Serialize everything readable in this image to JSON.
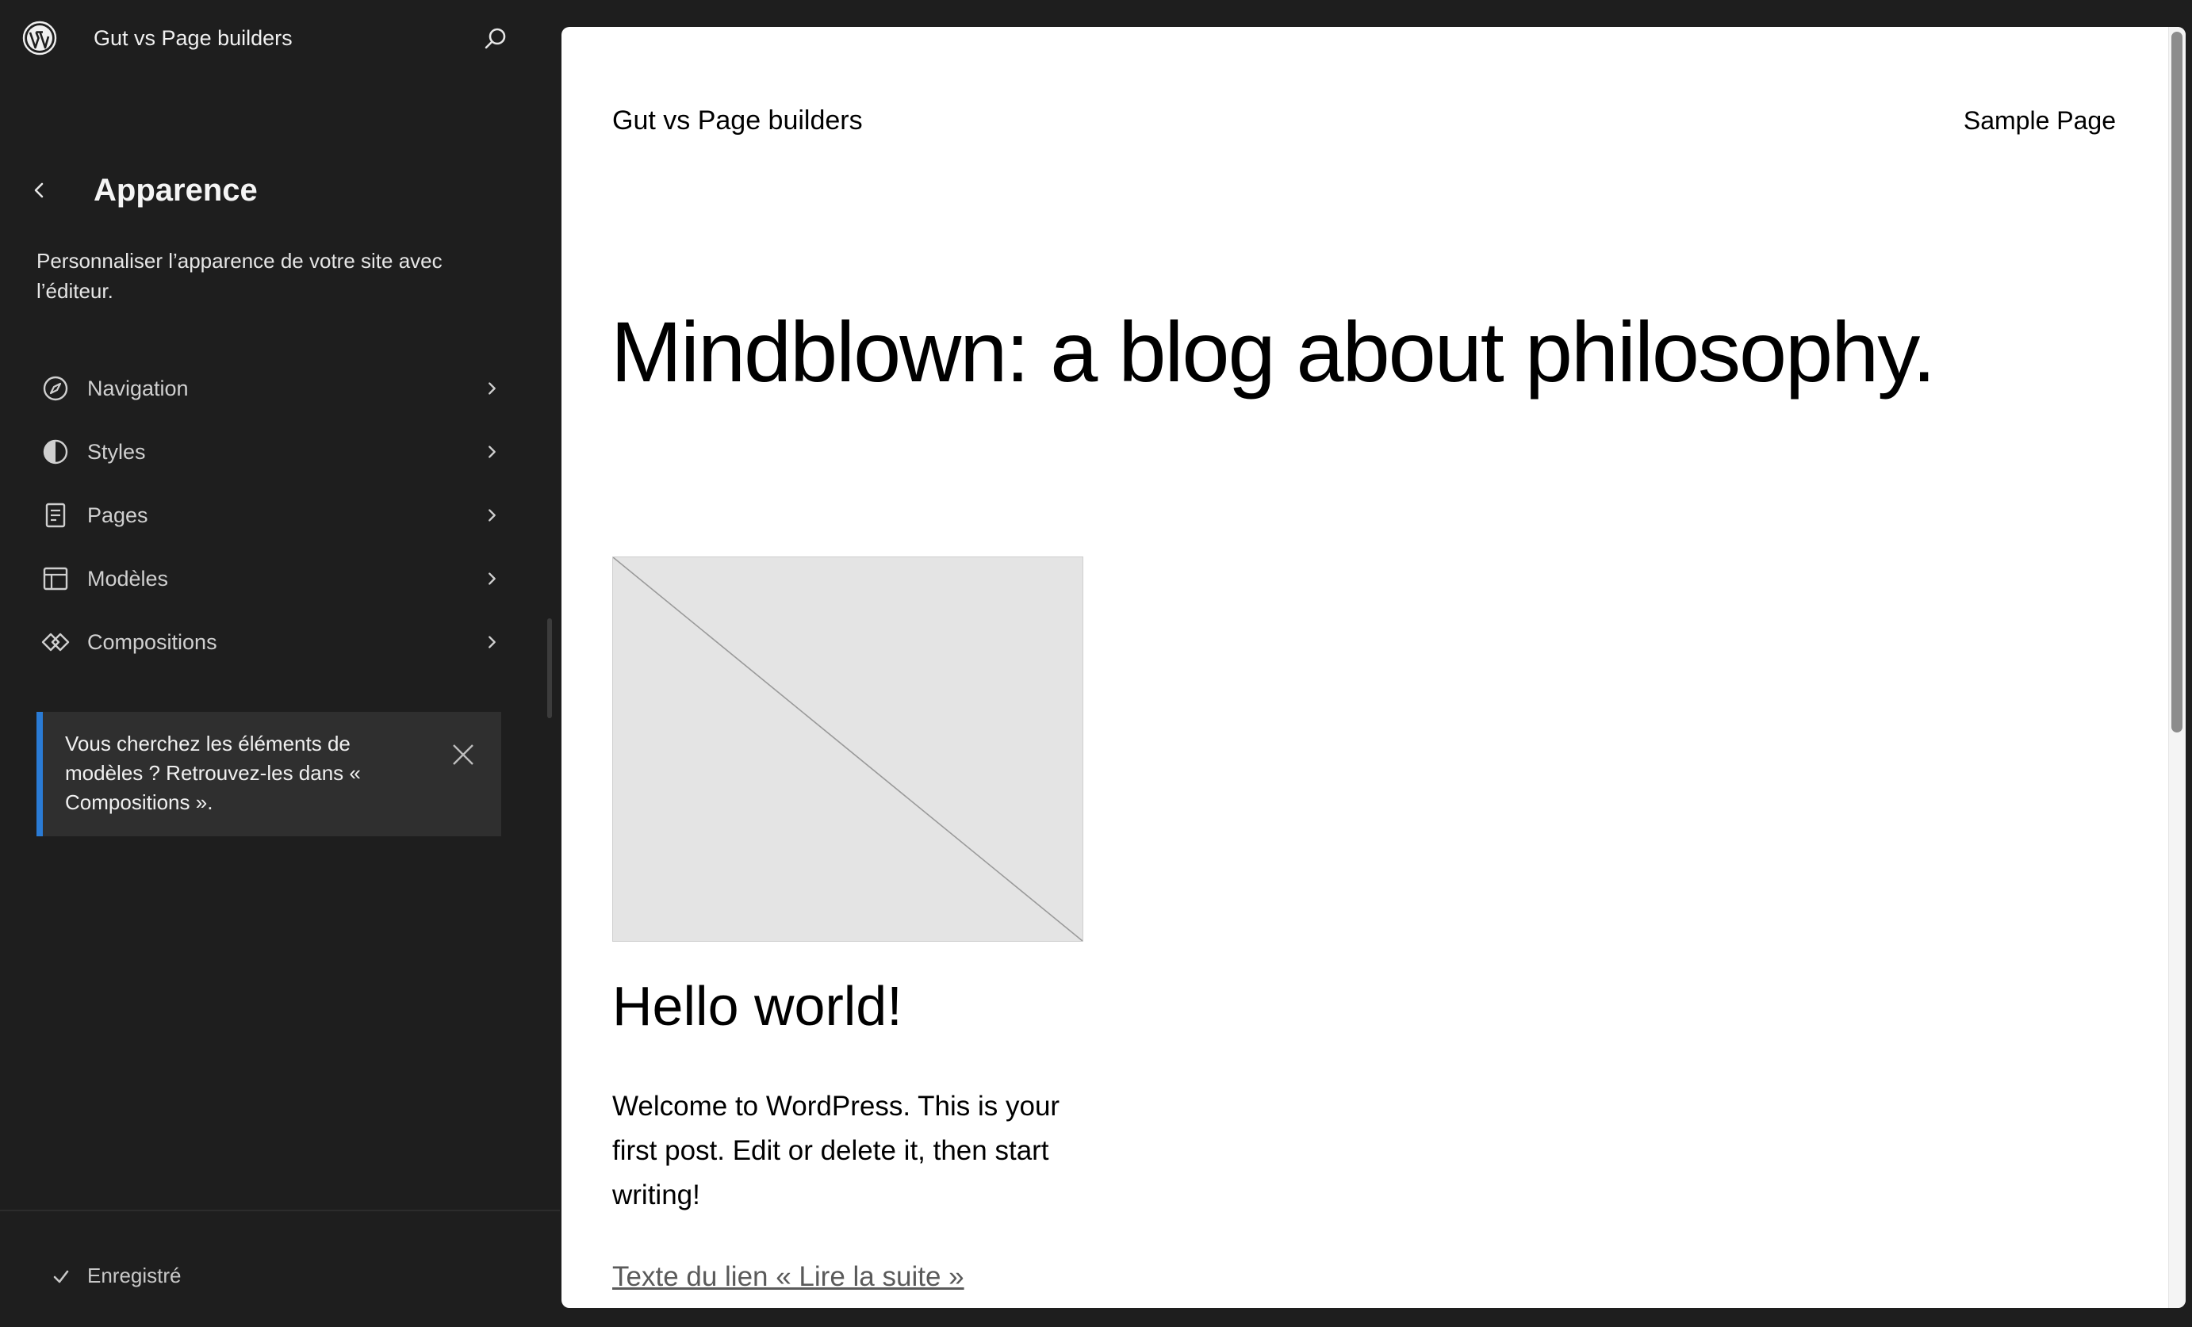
{
  "sidebar": {
    "site_title": "Gut vs Page builders",
    "section_title": "Apparence",
    "section_description": "Personnaliser l’apparence de votre site avec l’éditeur.",
    "menu_items": [
      {
        "label": "Navigation",
        "icon": "navigation-compass-icon"
      },
      {
        "label": "Styles",
        "icon": "styles-half-circle-icon"
      },
      {
        "label": "Pages",
        "icon": "page-icon"
      },
      {
        "label": "Modèles",
        "icon": "layout-icon"
      },
      {
        "label": "Compositions",
        "icon": "symbol-diamond-icon"
      }
    ],
    "notice": {
      "text": "Vous cherchez les éléments de modèles ? Retrouvez-les dans « Compositions ».",
      "accent_color": "#2a7bd5"
    },
    "save_status": "Enregistré"
  },
  "preview": {
    "site_title": "Gut vs Page builders",
    "nav_link": "Sample Page",
    "heading": "Mindblown: a blog about philosophy.",
    "post": {
      "title": "Hello world!",
      "excerpt": "Welcome to WordPress. This is your first post. Edit or delete it, then start writing!",
      "read_more": "Texte du lien « Lire la suite »"
    }
  },
  "colors": {
    "sidebar_bg": "#1e1e1e",
    "preview_bg": "#ffffff",
    "notice_bg": "#2f2f2f",
    "placeholder_bg": "#e4e4e4"
  }
}
